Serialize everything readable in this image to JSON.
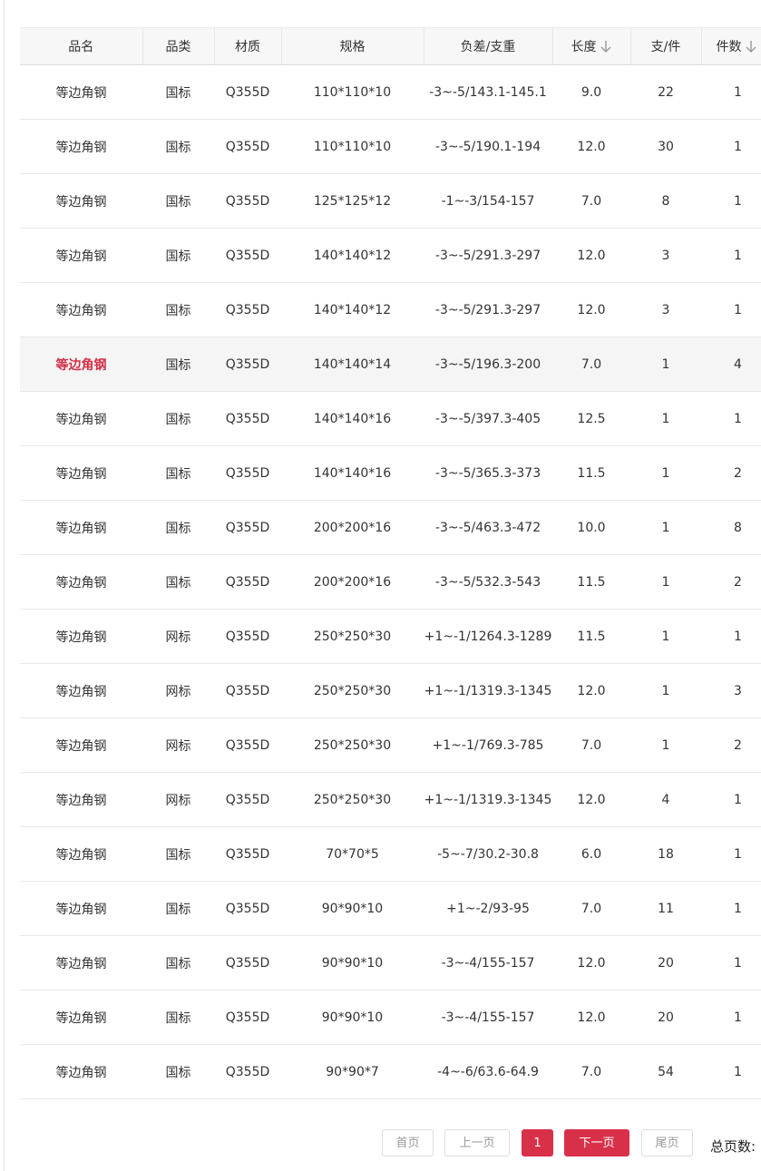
{
  "columns": [
    "品名",
    "品类",
    "材质",
    "规格",
    "负差/支重",
    "长度",
    "支/件",
    "件数"
  ],
  "rows": [
    {
      "name": "等边角钢",
      "category": "国标",
      "material": "Q355D",
      "spec": "110*110*10",
      "tolerance": "-3~-5/143.1-145.1",
      "length": "9.0",
      "pcs": "22",
      "count": "1"
    },
    {
      "name": "等边角钢",
      "category": "国标",
      "material": "Q355D",
      "spec": "110*110*10",
      "tolerance": "-3~-5/190.1-194",
      "length": "12.0",
      "pcs": "30",
      "count": "1"
    },
    {
      "name": "等边角钢",
      "category": "国标",
      "material": "Q355D",
      "spec": "125*125*12",
      "tolerance": "-1~-3/154-157",
      "length": "7.0",
      "pcs": "8",
      "count": "1"
    },
    {
      "name": "等边角钢",
      "category": "国标",
      "material": "Q355D",
      "spec": "140*140*12",
      "tolerance": "-3~-5/291.3-297",
      "length": "12.0",
      "pcs": "3",
      "count": "1"
    },
    {
      "name": "等边角钢",
      "category": "国标",
      "material": "Q355D",
      "spec": "140*140*12",
      "tolerance": "-3~-5/291.3-297",
      "length": "12.0",
      "pcs": "3",
      "count": "1"
    },
    {
      "name": "等边角钢",
      "category": "国标",
      "material": "Q355D",
      "spec": "140*140*14",
      "tolerance": "-3~-5/196.3-200",
      "length": "7.0",
      "pcs": "1",
      "count": "4"
    },
    {
      "name": "等边角钢",
      "category": "国标",
      "material": "Q355D",
      "spec": "140*140*16",
      "tolerance": "-3~-5/397.3-405",
      "length": "12.5",
      "pcs": "1",
      "count": "1"
    },
    {
      "name": "等边角钢",
      "category": "国标",
      "material": "Q355D",
      "spec": "140*140*16",
      "tolerance": "-3~-5/365.3-373",
      "length": "11.5",
      "pcs": "1",
      "count": "2"
    },
    {
      "name": "等边角钢",
      "category": "国标",
      "material": "Q355D",
      "spec": "200*200*16",
      "tolerance": "-3~-5/463.3-472",
      "length": "10.0",
      "pcs": "1",
      "count": "8"
    },
    {
      "name": "等边角钢",
      "category": "国标",
      "material": "Q355D",
      "spec": "200*200*16",
      "tolerance": "-3~-5/532.3-543",
      "length": "11.5",
      "pcs": "1",
      "count": "2"
    },
    {
      "name": "等边角钢",
      "category": "网标",
      "material": "Q355D",
      "spec": "250*250*30",
      "tolerance": "+1~-1/1264.3-1289",
      "length": "11.5",
      "pcs": "1",
      "count": "1"
    },
    {
      "name": "等边角钢",
      "category": "网标",
      "material": "Q355D",
      "spec": "250*250*30",
      "tolerance": "+1~-1/1319.3-1345",
      "length": "12.0",
      "pcs": "1",
      "count": "3"
    },
    {
      "name": "等边角钢",
      "category": "网标",
      "material": "Q355D",
      "spec": "250*250*30",
      "tolerance": "+1~-1/769.3-785",
      "length": "7.0",
      "pcs": "1",
      "count": "2"
    },
    {
      "name": "等边角钢",
      "category": "网标",
      "material": "Q355D",
      "spec": "250*250*30",
      "tolerance": "+1~-1/1319.3-1345",
      "length": "12.0",
      "pcs": "4",
      "count": "1"
    },
    {
      "name": "等边角钢",
      "category": "国标",
      "material": "Q355D",
      "spec": "70*70*5",
      "tolerance": "-5~-7/30.2-30.8",
      "length": "6.0",
      "pcs": "18",
      "count": "1"
    },
    {
      "name": "等边角钢",
      "category": "国标",
      "material": "Q355D",
      "spec": "90*90*10",
      "tolerance": "+1~-2/93-95",
      "length": "7.0",
      "pcs": "11",
      "count": "1"
    },
    {
      "name": "等边角钢",
      "category": "国标",
      "material": "Q355D",
      "spec": "90*90*10",
      "tolerance": "-3~-4/155-157",
      "length": "12.0",
      "pcs": "20",
      "count": "1"
    },
    {
      "name": "等边角钢",
      "category": "国标",
      "material": "Q355D",
      "spec": "90*90*10",
      "tolerance": "-3~-4/155-157",
      "length": "12.0",
      "pcs": "20",
      "count": "1"
    },
    {
      "name": "等边角钢",
      "category": "国标",
      "material": "Q355D",
      "spec": "90*90*7",
      "tolerance": "-4~-6/63.6-64.9",
      "length": "7.0",
      "pcs": "54",
      "count": "1"
    }
  ],
  "highlight_row_index": 5,
  "pagination": {
    "first": "首页",
    "prev": "上一页",
    "current": "1",
    "next": "下一页",
    "last": "尾页",
    "total_label": "总页数:"
  },
  "colors": {
    "accent": "#d9304a",
    "highlight_text": "#d32d46",
    "header_bg": "#f7f7f7"
  }
}
